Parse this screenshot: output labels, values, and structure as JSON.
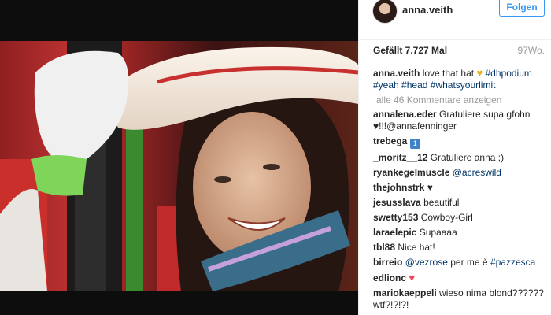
{
  "post": {
    "username": "anna.veith",
    "follow_label": "Folgen",
    "likes": "Gefällt 7.727 Mal",
    "age": "97Wo.",
    "caption": {
      "user": "anna.veith",
      "text": "love that hat",
      "tags": [
        "#dhpodium",
        "#yeah",
        "#head",
        "#whatsyourlimit"
      ]
    },
    "view_all": "alle 46 Kommentare anzeigen"
  },
  "comments": [
    {
      "user": "annalena.eder",
      "text": "Gratuliere supa gfohn",
      "cont": "!!!@annafenninger"
    },
    {
      "user": "trebega",
      "text": ""
    },
    {
      "user": "_moritz__12",
      "text": "Gratuliere anna ;)"
    },
    {
      "user": "ryankegelmuscle",
      "text": "@acreswild"
    },
    {
      "user": "thejohnstrk",
      "text": ""
    },
    {
      "user": "jesusslava",
      "text": "beautiful"
    },
    {
      "user": "swetty153",
      "text": "Cowboy-Girl"
    },
    {
      "user": "laraelepic",
      "text": "Supaaaa"
    },
    {
      "user": "tbl88",
      "text": "Nice hat!"
    },
    {
      "user": "birreio",
      "mention": "@vezrose",
      "text": "per me è",
      "tag": "#pazzesca"
    },
    {
      "user": "edlionc",
      "text": ""
    },
    {
      "user": "mariokaeppeli",
      "text": "wieso nima blond??????",
      "cont": "wtf?!?!?!"
    }
  ],
  "icons": {
    "caption_heart": "yellow-heart-icon",
    "trebega_emoji": "keycap-one-icon",
    "thejohnstrk_heart": "black-heart-icon",
    "edlionc_heart": "red-heart-icon",
    "annalena_heart": "heart-icon"
  }
}
